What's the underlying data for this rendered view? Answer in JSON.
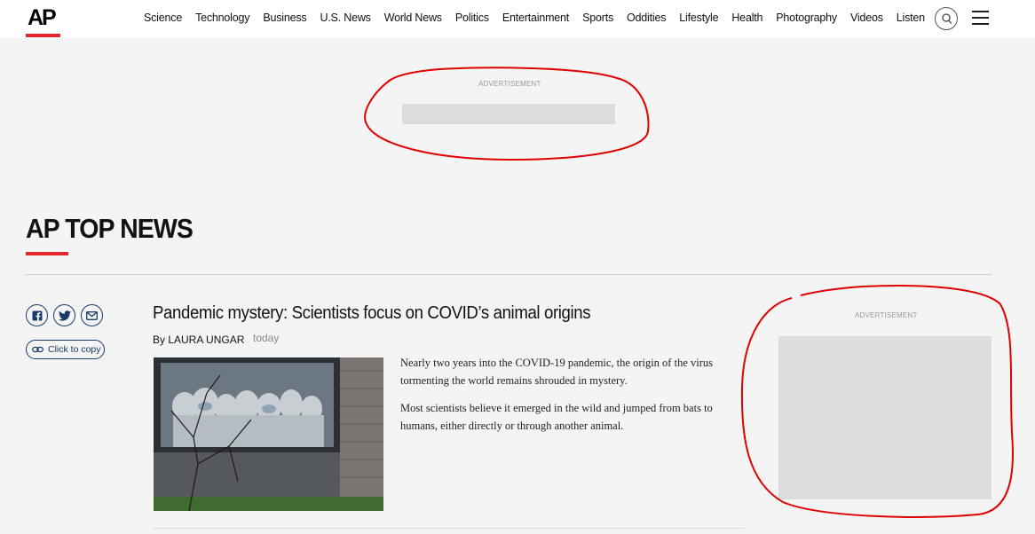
{
  "header": {
    "logo": "AP",
    "nav": [
      "Science",
      "Technology",
      "Business",
      "U.S. News",
      "World News",
      "Politics",
      "Entertainment",
      "Sports",
      "Oddities",
      "Lifestyle",
      "Health",
      "Photography",
      "Videos",
      "Listen"
    ]
  },
  "ads": {
    "top_label": "ADVERTISEMENT",
    "side_label": "ADVERTISEMENT"
  },
  "section": {
    "title": "AP TOP NEWS"
  },
  "share": {
    "icons": [
      "facebook-icon",
      "twitter-icon",
      "email-icon"
    ],
    "copy_label": "Click to copy"
  },
  "article": {
    "headline": "Pandemic mystery: Scientists focus on COVID’s animal origins",
    "byline": "By LAURA UNGAR",
    "timestamp": "today",
    "paragraphs": [
      "Nearly two years into the COVID-19 pandemic, the origin of the virus tormenting the world remains shrouded in mystery.",
      "Most scientists believe it emerged in the wild and jumped from bats to humans, either directly or through another animal."
    ]
  },
  "colors": {
    "brand_red": "#e8262d",
    "link_blue": "#1a3a6b",
    "annotation_red": "#e00000"
  }
}
